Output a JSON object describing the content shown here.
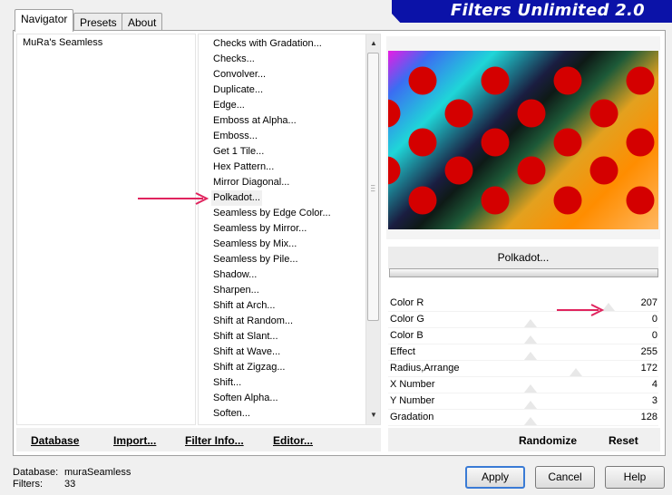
{
  "tabs": [
    {
      "label": "Navigator",
      "active": true
    },
    {
      "label": "Presets",
      "active": false
    },
    {
      "label": "About",
      "active": false
    }
  ],
  "title_banner": "Filters Unlimited 2.0",
  "categories": {
    "selected": "MuRa's Seamless"
  },
  "filters": [
    "Checks with Gradation...",
    "Checks...",
    "Convolver...",
    "Duplicate...",
    "Edge...",
    "Emboss at Alpha...",
    "Emboss...",
    "Get 1 Tile...",
    "Hex Pattern...",
    "Mirror Diagonal...",
    "Polkadot...",
    "Seamless by Edge Color...",
    "Seamless by Mirror...",
    "Seamless by Mix...",
    "Seamless by Pile...",
    "Shadow...",
    "Sharpen...",
    "Shift at Arch...",
    "Shift at Random...",
    "Shift at Slant...",
    "Shift at Wave...",
    "Shift at Zigzag...",
    "Shift...",
    "Soften Alpha...",
    "Soften..."
  ],
  "selected_filter": "Polkadot...",
  "preview": {
    "dot_color": "#d40000"
  },
  "params": [
    {
      "name": "Color R",
      "value": "207"
    },
    {
      "name": "Color G",
      "value": "0"
    },
    {
      "name": "Color B",
      "value": "0"
    },
    {
      "name": "Effect",
      "value": "255"
    },
    {
      "name": "Radius,Arrange",
      "value": "172"
    },
    {
      "name": "X Number",
      "value": "4"
    },
    {
      "name": "Y Number",
      "value": "3"
    },
    {
      "name": "Gradation",
      "value": "128"
    }
  ],
  "toolbar": {
    "database": "Database",
    "import": "Import...",
    "filter_info": "Filter Info...",
    "editor": "Editor...",
    "randomize": "Randomize",
    "reset": "Reset"
  },
  "status": {
    "database_label": "Database:",
    "database_value": "muraSeamless",
    "filters_label": "Filters:",
    "filters_value": "33"
  },
  "dialog_buttons": {
    "apply": "Apply",
    "cancel": "Cancel",
    "help": "Help"
  },
  "colors": {
    "accent_arrow": "#e0245e",
    "banner": "#0b12a8",
    "default_button_border": "#3a7bd5"
  }
}
